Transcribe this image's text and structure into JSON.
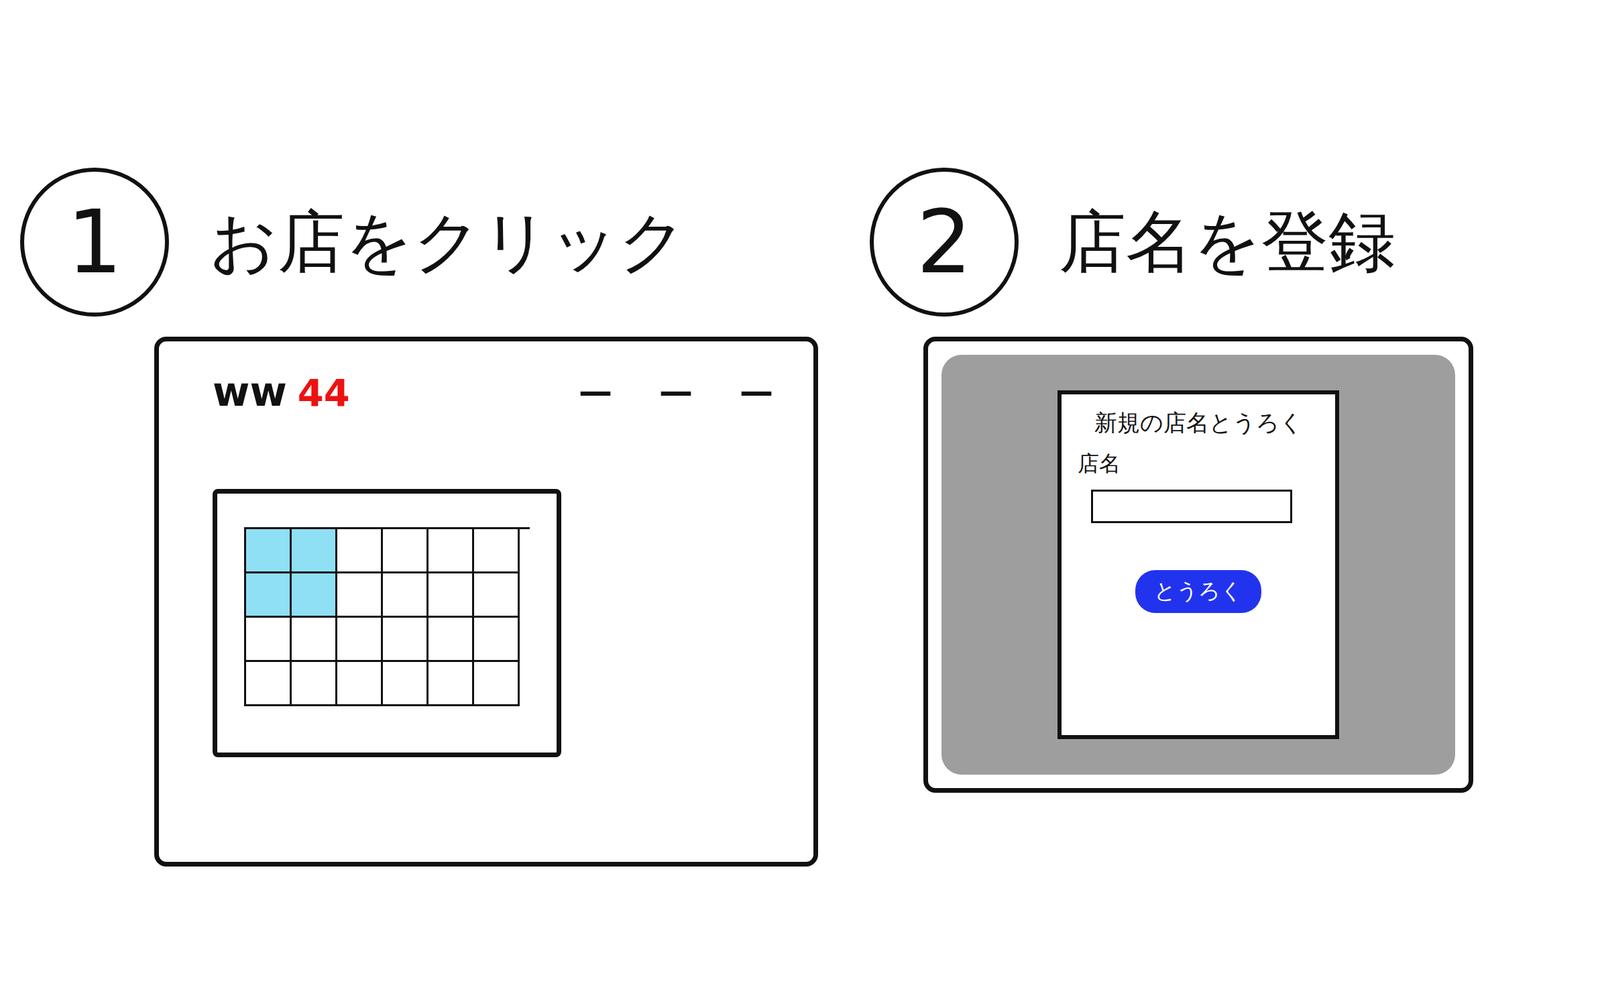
{
  "steps": [
    {
      "number": "1",
      "title": "お店をクリック",
      "kind": "calendar",
      "screen": {
        "logo": "ww",
        "badge": "44",
        "nav": [
          "—",
          "—",
          "—"
        ],
        "calendar": {
          "rows": [
            [
              {
                "selected": true
              },
              {
                "selected": true
              },
              {
                "selected": false
              },
              {
                "selected": false
              },
              {
                "selected": false
              },
              {
                "selected": false
              }
            ],
            [
              {
                "selected": true
              },
              {
                "selected": true
              },
              {
                "selected": false
              },
              {
                "selected": false
              },
              {
                "selected": false
              },
              {
                "selected": false
              }
            ],
            [
              {
                "selected": false
              },
              {
                "selected": false
              },
              {
                "selected": false
              },
              {
                "selected": false
              },
              {
                "selected": false
              },
              {
                "selected": false
              }
            ],
            [
              {
                "selected": false
              },
              {
                "selected": false
              },
              {
                "selected": false
              },
              {
                "selected": false
              },
              {
                "selected": false
              },
              {
                "selected": false
              }
            ]
          ]
        }
      }
    },
    {
      "number": "2",
      "title": "店名を登録",
      "kind": "dialog",
      "screen": {
        "dialog": {
          "title": "新規の店名とうろく",
          "label": "店名",
          "value": "",
          "button": "とうろく"
        }
      }
    }
  ]
}
